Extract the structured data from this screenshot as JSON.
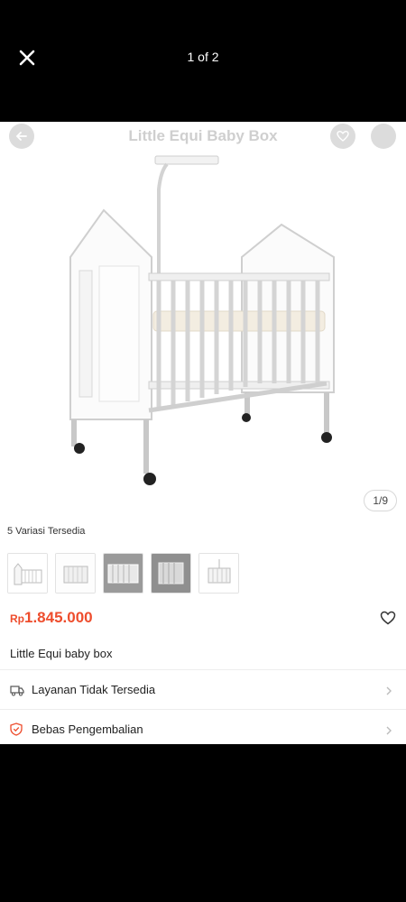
{
  "viewer": {
    "counter": "1 of 2"
  },
  "product_header": {
    "title": "Little Equi Baby Box"
  },
  "gallery": {
    "page_indicator": "1/9"
  },
  "variants": {
    "label": "5 Variasi Tersedia",
    "count": 5
  },
  "price": {
    "currency": "Rp",
    "value": "1.845.000",
    "color": "#ee4d2d"
  },
  "product": {
    "name": "Little Equi baby box"
  },
  "info_rows": [
    {
      "label": "Layanan Tidak Tersedia",
      "icon": "truck-icon"
    },
    {
      "label": "Bebas Pengembalian",
      "icon": "shield-icon"
    }
  ],
  "icons": {
    "close": "close-icon",
    "back": "back-arrow-icon",
    "heart": "heart-icon",
    "more": "more-icon",
    "favorite": "heart-outline-icon",
    "chevron": "chevron-right-icon"
  }
}
